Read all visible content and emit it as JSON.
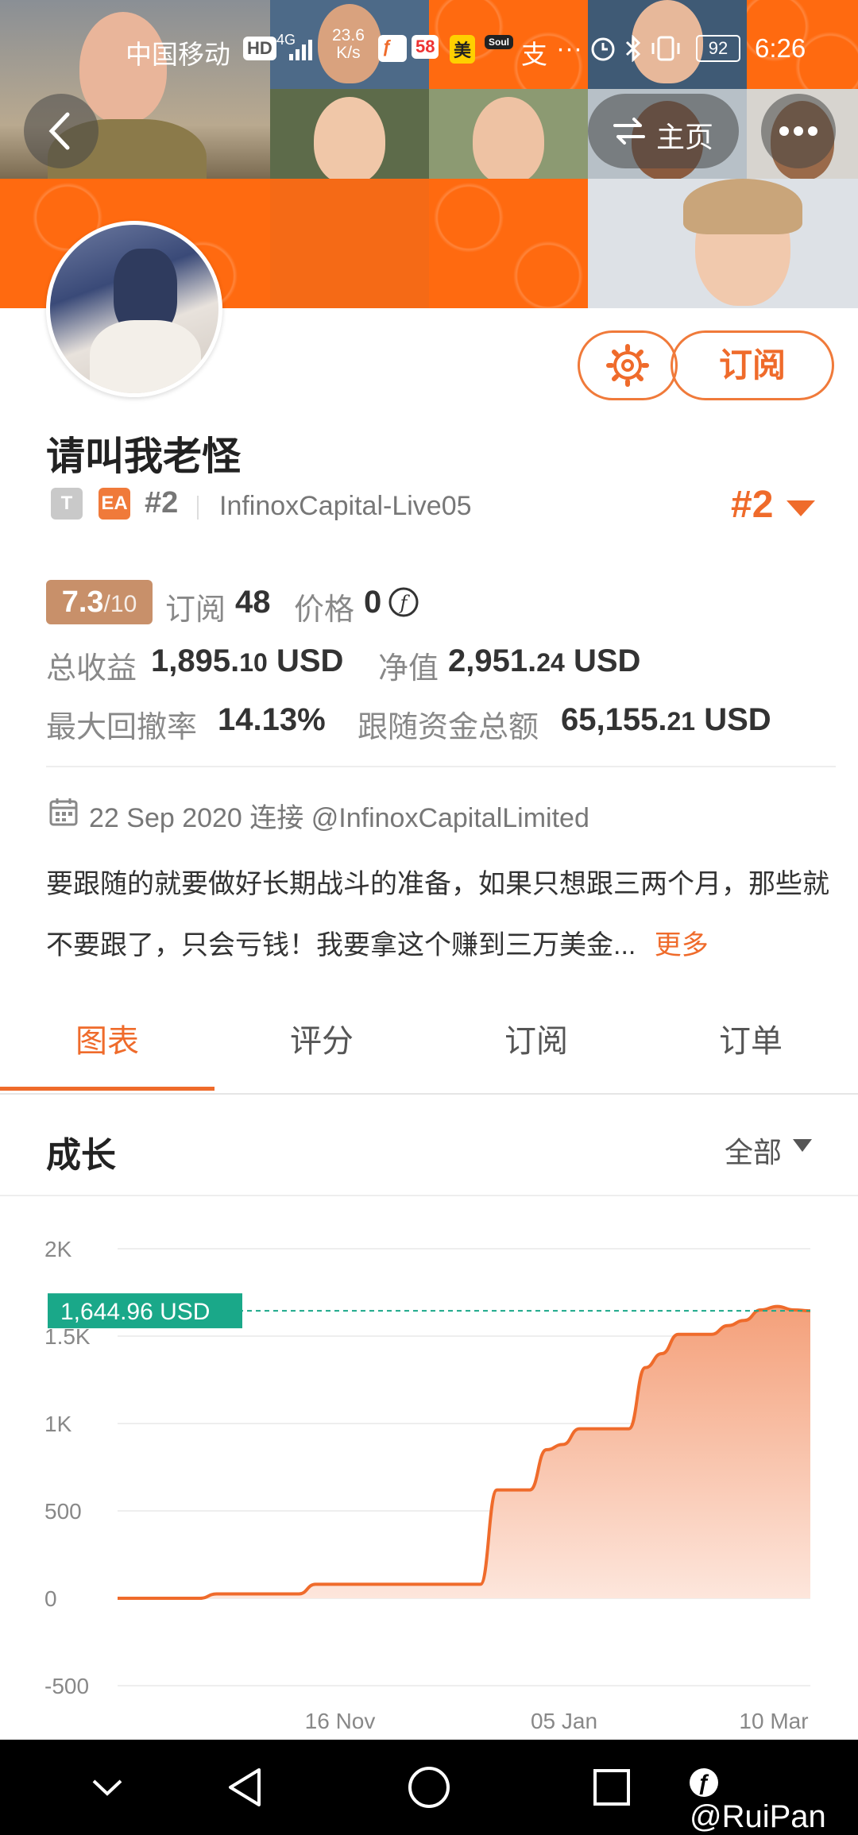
{
  "status_bar": {
    "carrier": "中国移动",
    "hd": "HD",
    "net": "4G",
    "speed_value": "23.6",
    "speed_unit": "K/s",
    "app1": "58",
    "app2": "美",
    "app3": "Soul",
    "app4": "支",
    "more": "···",
    "battery": "92",
    "time": "6:26"
  },
  "header": {
    "home_label": "主页"
  },
  "profile": {
    "subscribe_label": "订阅",
    "username": "请叫我老怪",
    "tag_t": "T",
    "tag_ea": "EA",
    "rank_small": "#2",
    "account": "InfinoxCapital-Live05",
    "rank_big": "#2"
  },
  "stats": {
    "score": "7.3",
    "score_max": "/10",
    "subscribers_label": "订阅",
    "subscribers": "48",
    "price_label": "价格",
    "price": "0",
    "total_profit_label": "总收益",
    "total_profit_int": "1,895.",
    "total_profit_dec": "10",
    "total_profit_unit": "USD",
    "equity_label": "净值",
    "equity_int": "2,951.",
    "equity_dec": "24",
    "equity_unit": "USD",
    "max_dd_label": "最大回撤率",
    "max_dd": "14.13%",
    "follow_label": "跟随资金总额",
    "follow_int": "65,155.",
    "follow_dec": "21",
    "follow_unit": "USD"
  },
  "connection": {
    "date": "22 Sep 2020",
    "connect_label": "连接",
    "broker": "@InfinoxCapitalLimited"
  },
  "description": {
    "text": "要跟随的就要做好长期战斗的准备，如果只想跟三两个月，那些就不要跟了，只会亏钱！我要拿这个赚到三万美金...",
    "more_label": "更多"
  },
  "tabs": [
    "图表",
    "评分",
    "订阅",
    "订单"
  ],
  "growth": {
    "title": "成长",
    "filter": "全部"
  },
  "nav": {
    "watermark": "@RuiPan"
  },
  "colors": {
    "accent": "#ef6b2b",
    "teal": "#1aa889",
    "score_bg": "#c8906a"
  },
  "chart_data": {
    "type": "area",
    "y_ticks": [
      "2K",
      "1.5K",
      "1K",
      "500",
      "0",
      "-500"
    ],
    "y_tick_values": [
      2000,
      1500,
      1000,
      500,
      0,
      -500
    ],
    "ylim": [
      -500,
      2000
    ],
    "x_ticks": [
      "16 Nov",
      "05 Jan",
      "10 Mar"
    ],
    "current_label": "1,644.96 USD",
    "current_value": 1644.96,
    "series": [
      {
        "values": [
          0,
          0,
          0,
          0,
          0,
          0,
          25,
          25,
          25,
          25,
          25,
          25,
          80,
          80,
          80,
          80,
          80,
          80,
          80,
          80,
          80,
          80,
          80,
          620,
          620,
          620,
          850,
          880,
          970,
          970,
          970,
          970,
          1320,
          1400,
          1510,
          1510,
          1510,
          1560,
          1590,
          1650,
          1670,
          1650,
          1645
        ]
      }
    ]
  }
}
